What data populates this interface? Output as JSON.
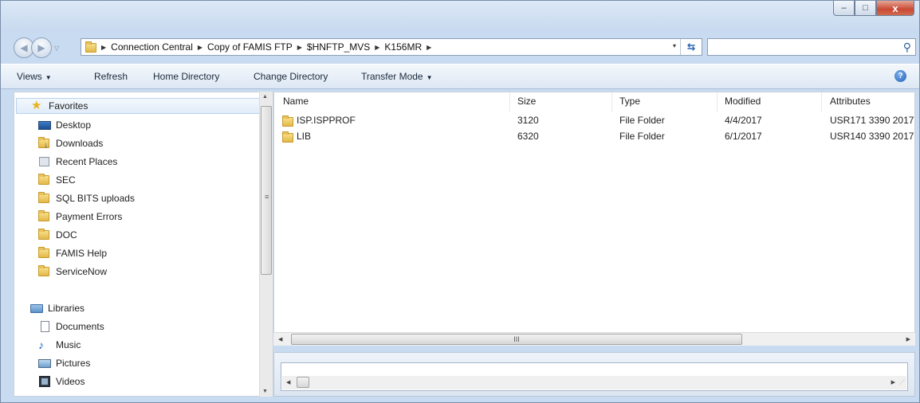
{
  "window": {
    "caption_buttons": {
      "minimize": "–",
      "maximize": "□",
      "close": "x"
    }
  },
  "nav": {
    "back_icon": "◀",
    "forward_icon": "▶",
    "history_dropdown": "▽"
  },
  "address": {
    "crumbs": [
      "Connection Central",
      "Copy of FAMIS FTP",
      "$HNFTP_MVS",
      "K156MR"
    ],
    "separator": "▶",
    "dropdown": "▾",
    "refresh_icon": "⇆"
  },
  "search": {
    "value": "",
    "icon": "⚲"
  },
  "toolbar": {
    "views": "Views",
    "refresh": "Refresh",
    "home_directory": "Home Directory",
    "change_directory": "Change Directory",
    "transfer_mode": "Transfer Mode",
    "dropdown_caret": "▼",
    "help": "?"
  },
  "sidebar": {
    "favorites_label": "Favorites",
    "favorites": [
      "Desktop",
      "Downloads",
      "Recent Places",
      "SEC",
      "SQL BITS uploads",
      "Payment Errors",
      "DOC",
      "FAMIS Help",
      "ServiceNow"
    ],
    "libraries_label": "Libraries",
    "libraries": [
      "Documents",
      "Music",
      "Pictures",
      "Videos"
    ]
  },
  "columns": [
    "Name",
    "Size",
    "Type",
    "Modified",
    "Attributes"
  ],
  "files": [
    {
      "name": "ISP.ISPPROF",
      "size": "3120",
      "type": "File Folder",
      "modified": "4/4/2017",
      "attributes": "USR171 3390  2017"
    },
    {
      "name": "LIB",
      "size": "6320",
      "type": "File Folder",
      "modified": "6/1/2017",
      "attributes": "USR140 3390  2017"
    }
  ],
  "scrollbar": {
    "grip": "III",
    "grip_v": "≡",
    "up": "▲",
    "down": "▼",
    "left": "◀",
    "right": "▶",
    "corner": "⋰"
  },
  "colors": {
    "chrome": "#c9dbf0",
    "selection": "#e1ecf9",
    "folder": "#e3b84a",
    "close_button": "#c94a33"
  }
}
